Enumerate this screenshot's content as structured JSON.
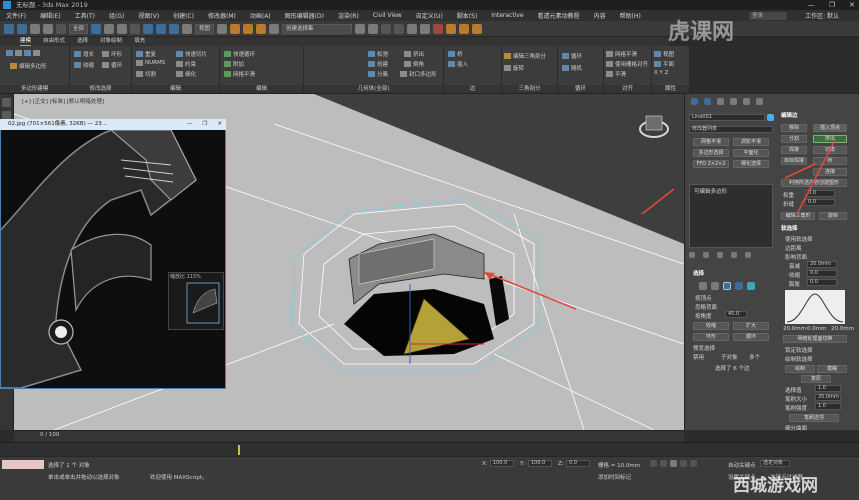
{
  "window": {
    "title": "无标题 - 3ds Max 2019",
    "buttons": [
      "—",
      "❐",
      "✕"
    ]
  },
  "menubar": {
    "items": [
      "文件(F)",
      "编辑(E)",
      "工具(T)",
      "组(G)",
      "视图(V)",
      "创建(C)",
      "修改器(M)",
      "动画(A)",
      "图形编辑器(D)",
      "渲染(R)",
      "Civil View",
      "自定义(U)",
      "脚本(S)",
      "Interactive",
      "看透元素动教程",
      "内容",
      "帮助(H)"
    ],
    "search_placeholder": "登录",
    "workspace": "工作区: 默认"
  },
  "toolbar": {
    "selection_filter": "全部",
    "view_dropdown": "视图",
    "named_set": "创建选择集"
  },
  "ribbon": {
    "tabs": [
      "建模",
      "自由形式",
      "选择",
      "对象绘制",
      "填充"
    ],
    "active_tab": "建模",
    "groups": [
      {
        "label": "多边形建模",
        "items": [
          "编辑多边形"
        ]
      },
      {
        "label": "修改选择",
        "items": [
          "增长",
          "收缩",
          "环形",
          "循环"
        ]
      },
      {
        "label": "编辑",
        "items": [
          "重复",
          "快速切片",
          "快速循环",
          "NURMS",
          "切割",
          "约束",
          "细化",
          "附加",
          "网格平滑"
        ]
      },
      {
        "label": "几何体(全部)",
        "items": [
          "松弛",
          "创建",
          "挤出",
          "分离",
          "倒角",
          "封口多边形"
        ]
      },
      {
        "label": "边",
        "items": [
          "桥",
          "利用所选内容创建图形",
          "插入"
        ]
      },
      {
        "label": "三角剖分",
        "items": [
          "编辑三角剖分",
          "旋转"
        ]
      },
      {
        "label": "循环",
        "items": [
          "循环",
          "随机"
        ]
      },
      {
        "label": "对齐",
        "items": [
          "网格平滑",
          "使用栅格对齐",
          "平滑"
        ]
      },
      {
        "label": "属性",
        "items": [
          "视图",
          "平面",
          "X Y Z",
          "平面化"
        ]
      }
    ]
  },
  "viewport": {
    "label": "[+] [正交] [标准] [默认明暗处理]"
  },
  "image_window": {
    "title": "02.jpg (701×561像素, 32KB) — 23...",
    "buttons": [
      "—",
      "❐",
      "✕"
    ],
    "nav_label": "缩放比 115%"
  },
  "command_panel": {
    "object_name": "Line001",
    "modifier_list": "修改器列表",
    "modifier_buttons": [
      "网格平滑",
      "涡轮平滑",
      "多边形选择",
      "平面化",
      "FFD 2×2×2",
      "细化选择"
    ],
    "stack_item": "可编辑多边形",
    "edit_edges": {
      "title": "编辑边",
      "insert_vertex": "插入顶点",
      "remove": "移除",
      "split": "分割",
      "extrude": "挤出",
      "weld": "焊接",
      "chamfer": "切角",
      "target_weld": "目标焊接",
      "bridge": "桥",
      "connect": "连接",
      "create_shape": "利用所选内容创建图形",
      "weight_label": "权重",
      "crease_label": "折缝",
      "weight_val": "0.0",
      "crease_val": "0.0",
      "edit_tri": "编辑三角形",
      "turn": "旋转"
    },
    "soft_selection": {
      "title": "软选择",
      "use_soft": "使用软选择",
      "edge_distance": "边距离",
      "affect_backface": "影响背面",
      "falloff": "衰减",
      "pinch": "收缩",
      "bubble": "膨胀",
      "falloff_val": "20.0mm",
      "pinch_val": "0.0",
      "bubble_val": "0.0",
      "curve_left": "20.0mm",
      "curve_mid": "0.0mm",
      "curve_right": "20.0mm",
      "shaded_face": "明暗处理面切换",
      "lock": "锁定软选择",
      "paint": "绘制软选择",
      "paint_btn": "绘制",
      "blur_btn": "模糊",
      "revert_btn": "复原",
      "select_value": "选择值",
      "brush_size": "笔刷大小",
      "brush_strength": "笔刷强度",
      "brush_options": "笔刷选项",
      "sv_val": "1.0",
      "bs_val": "20.0mm",
      "bstr_val": "1.0"
    },
    "selection": {
      "title": "选择",
      "by_vertex": "按顶点",
      "ignore_backface": "忽略背面",
      "by_angle": "按角度",
      "angle_val": "45.0",
      "shrink": "收缩",
      "grow": "扩大",
      "ring": "环形",
      "loop": "循环",
      "preview": "预览选择",
      "disabled": "禁用",
      "subobject": "子对象",
      "multi": "多个",
      "selected_count": "选择了 6 个边"
    },
    "frame_label": "帧",
    "bottom_label": "细分曲面"
  },
  "timeline": {
    "frame": "0 / 100"
  },
  "status": {
    "selected": "选择了 1 个 对象",
    "prompt": "单击或单击并拖动以选择对象",
    "hint": "欢迎使用 MAXScript。",
    "x_label": "X:",
    "x_val": "100.0",
    "y_label": "Y:",
    "y_val": "100.0",
    "z_label": "Z:",
    "z_val": "0.0",
    "grid": "栅格 = 10.0mm",
    "autokey": "自动关键点",
    "set_key": "设置关键点",
    "selected_obj": "选定对象",
    "add_time_tag": "添加时间标记",
    "keyfilter": "关键点过滤器..."
  },
  "watermarks": {
    "top": "虎课网",
    "bottom": "西城游戏网"
  },
  "colors": {
    "accent": "#e04a3a",
    "selection": "#4e8cd0",
    "panel": "#444444",
    "viewport_bg": "#9d9d9d"
  }
}
